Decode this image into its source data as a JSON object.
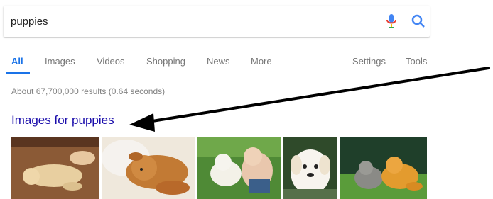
{
  "search": {
    "query": "puppies"
  },
  "tabs": [
    {
      "label": "All",
      "active": true
    },
    {
      "label": "Images"
    },
    {
      "label": "Videos"
    },
    {
      "label": "Shopping"
    },
    {
      "label": "News"
    },
    {
      "label": "More"
    },
    {
      "label": "Settings"
    },
    {
      "label": "Tools"
    }
  ],
  "results": {
    "stats": "About 67,700,000 results (0.64 seconds)"
  },
  "images_section": {
    "heading": "Images for puppies"
  },
  "colors": {
    "accent": "#1a73e8",
    "link": "#1a0dab",
    "mic_red": "#ea4335"
  }
}
